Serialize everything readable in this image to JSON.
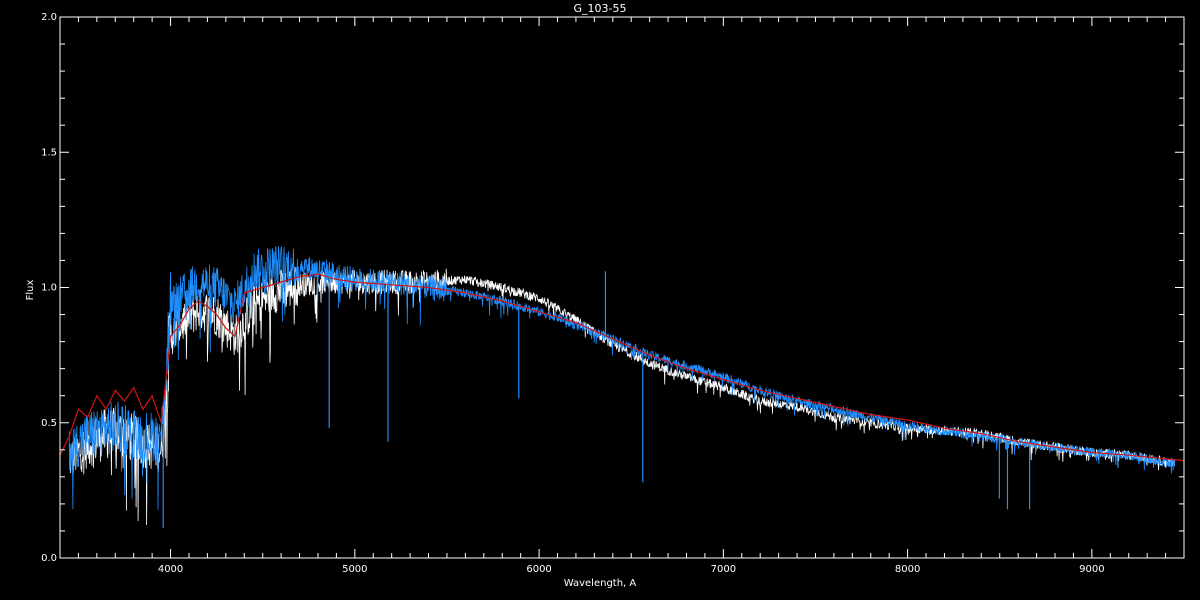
{
  "chart_data": {
    "type": "line",
    "title": "G_103-55",
    "xlabel": "Wavelength, A",
    "ylabel": "Flux",
    "xlim": [
      3400,
      9500
    ],
    "ylim": [
      0.0,
      2.0
    ],
    "xticks": [
      4000,
      5000,
      6000,
      7000,
      8000,
      9000
    ],
    "xtick_labels": [
      "4000",
      "5000",
      "6000",
      "7000",
      "8000",
      "9000"
    ],
    "yticks": [
      0.0,
      0.5,
      1.0,
      1.5,
      2.0
    ],
    "ytick_labels": [
      "0.0",
      "0.5",
      "1.0",
      "1.5",
      "2.0"
    ],
    "background": "#000000",
    "axis_color": "#ffffff",
    "series": [
      {
        "color": "#ffffff",
        "style": "noisy-spectrum",
        "x": [
          3450,
          3550,
          3650,
          3750,
          3850,
          3950,
          4000,
          4050,
          4150,
          4250,
          4350,
          4450,
          4550,
          4700,
          4850,
          5000,
          5200,
          5400,
          5600,
          5800,
          5900,
          6000,
          6100,
          6200,
          6400,
          6600,
          6800,
          7000,
          7200,
          7400,
          7600,
          7800,
          8000,
          8200,
          8400,
          8600,
          8800,
          9000,
          9200,
          9450
        ],
        "y": [
          0.36,
          0.42,
          0.46,
          0.46,
          0.42,
          0.4,
          0.82,
          0.86,
          0.92,
          0.9,
          0.82,
          0.93,
          0.98,
          1.01,
          1.02,
          1.02,
          1.02,
          1.02,
          1.03,
          1.0,
          0.98,
          0.96,
          0.92,
          0.88,
          0.79,
          0.72,
          0.67,
          0.63,
          0.58,
          0.56,
          0.52,
          0.5,
          0.48,
          0.47,
          0.46,
          0.43,
          0.41,
          0.39,
          0.38,
          0.35
        ]
      },
      {
        "color": "#1f8fff",
        "style": "noisy-spectrum",
        "x": [
          3450,
          3550,
          3650,
          3750,
          3850,
          3950,
          4000,
          4050,
          4150,
          4250,
          4350,
          4450,
          4550,
          4700,
          4850,
          5000,
          5200,
          5400,
          5600,
          5800,
          5900,
          6000,
          6100,
          6200,
          6400,
          6600,
          6800,
          7000,
          7200,
          7400,
          7600,
          7800,
          8000,
          8200,
          8400,
          8600,
          8800,
          9000,
          9200,
          9450
        ],
        "y": [
          0.4,
          0.45,
          0.48,
          0.48,
          0.45,
          0.45,
          0.92,
          0.96,
          1.02,
          1.0,
          0.93,
          1.06,
          1.08,
          1.08,
          1.06,
          1.03,
          1.02,
          1.0,
          0.98,
          0.95,
          0.93,
          0.91,
          0.89,
          0.86,
          0.81,
          0.75,
          0.71,
          0.67,
          0.62,
          0.58,
          0.55,
          0.52,
          0.49,
          0.47,
          0.45,
          0.43,
          0.41,
          0.39,
          0.38,
          0.35
        ]
      },
      {
        "color": "#d21414",
        "style": "smooth",
        "x": [
          3400,
          3450,
          3500,
          3550,
          3600,
          3650,
          3700,
          3750,
          3800,
          3850,
          3900,
          3950,
          4000,
          4050,
          4100,
          4150,
          4200,
          4250,
          4300,
          4350,
          4400,
          4500,
          4600,
          4700,
          4800,
          4900,
          5000,
          5200,
          5400,
          5600,
          5800,
          6000,
          6200,
          6400,
          6600,
          6800,
          7000,
          7200,
          7400,
          7600,
          7800,
          8000,
          8200,
          8400,
          8600,
          8800,
          9000,
          9200,
          9500
        ],
        "y": [
          0.38,
          0.45,
          0.55,
          0.52,
          0.6,
          0.55,
          0.62,
          0.58,
          0.63,
          0.55,
          0.6,
          0.5,
          0.82,
          0.86,
          0.92,
          0.95,
          0.93,
          0.9,
          0.85,
          0.82,
          0.98,
          1.0,
          1.02,
          1.04,
          1.05,
          1.03,
          1.02,
          1.01,
          1.0,
          0.98,
          0.95,
          0.91,
          0.87,
          0.81,
          0.75,
          0.7,
          0.66,
          0.62,
          0.59,
          0.56,
          0.53,
          0.51,
          0.48,
          0.46,
          0.43,
          0.41,
          0.39,
          0.38,
          0.36
        ]
      },
      {
        "color": "#1f8fff",
        "style": "baseline",
        "x": [
          3400,
          9500
        ],
        "y": [
          0.0,
          0.0
        ]
      }
    ],
    "spikes": [
      {
        "x": 6360,
        "y": 1.06,
        "color": "#1f8fff"
      },
      {
        "x": 5890,
        "y": 0.59,
        "color": "#1f8fff"
      },
      {
        "x": 6563,
        "y": 0.28,
        "color": "#1f8fff"
      },
      {
        "x": 5180,
        "y": 0.43,
        "color": "#1f8fff"
      },
      {
        "x": 4861,
        "y": 0.48,
        "color": "#1f8fff"
      },
      {
        "x": 3960,
        "y": 0.11,
        "color": "#1f8fff"
      },
      {
        "x": 8542,
        "y": 0.18,
        "color": "#1f8fff"
      },
      {
        "x": 8662,
        "y": 0.18,
        "color": "#1f8fff"
      },
      {
        "x": 8498,
        "y": 0.22,
        "color": "#1f8fff"
      }
    ]
  }
}
